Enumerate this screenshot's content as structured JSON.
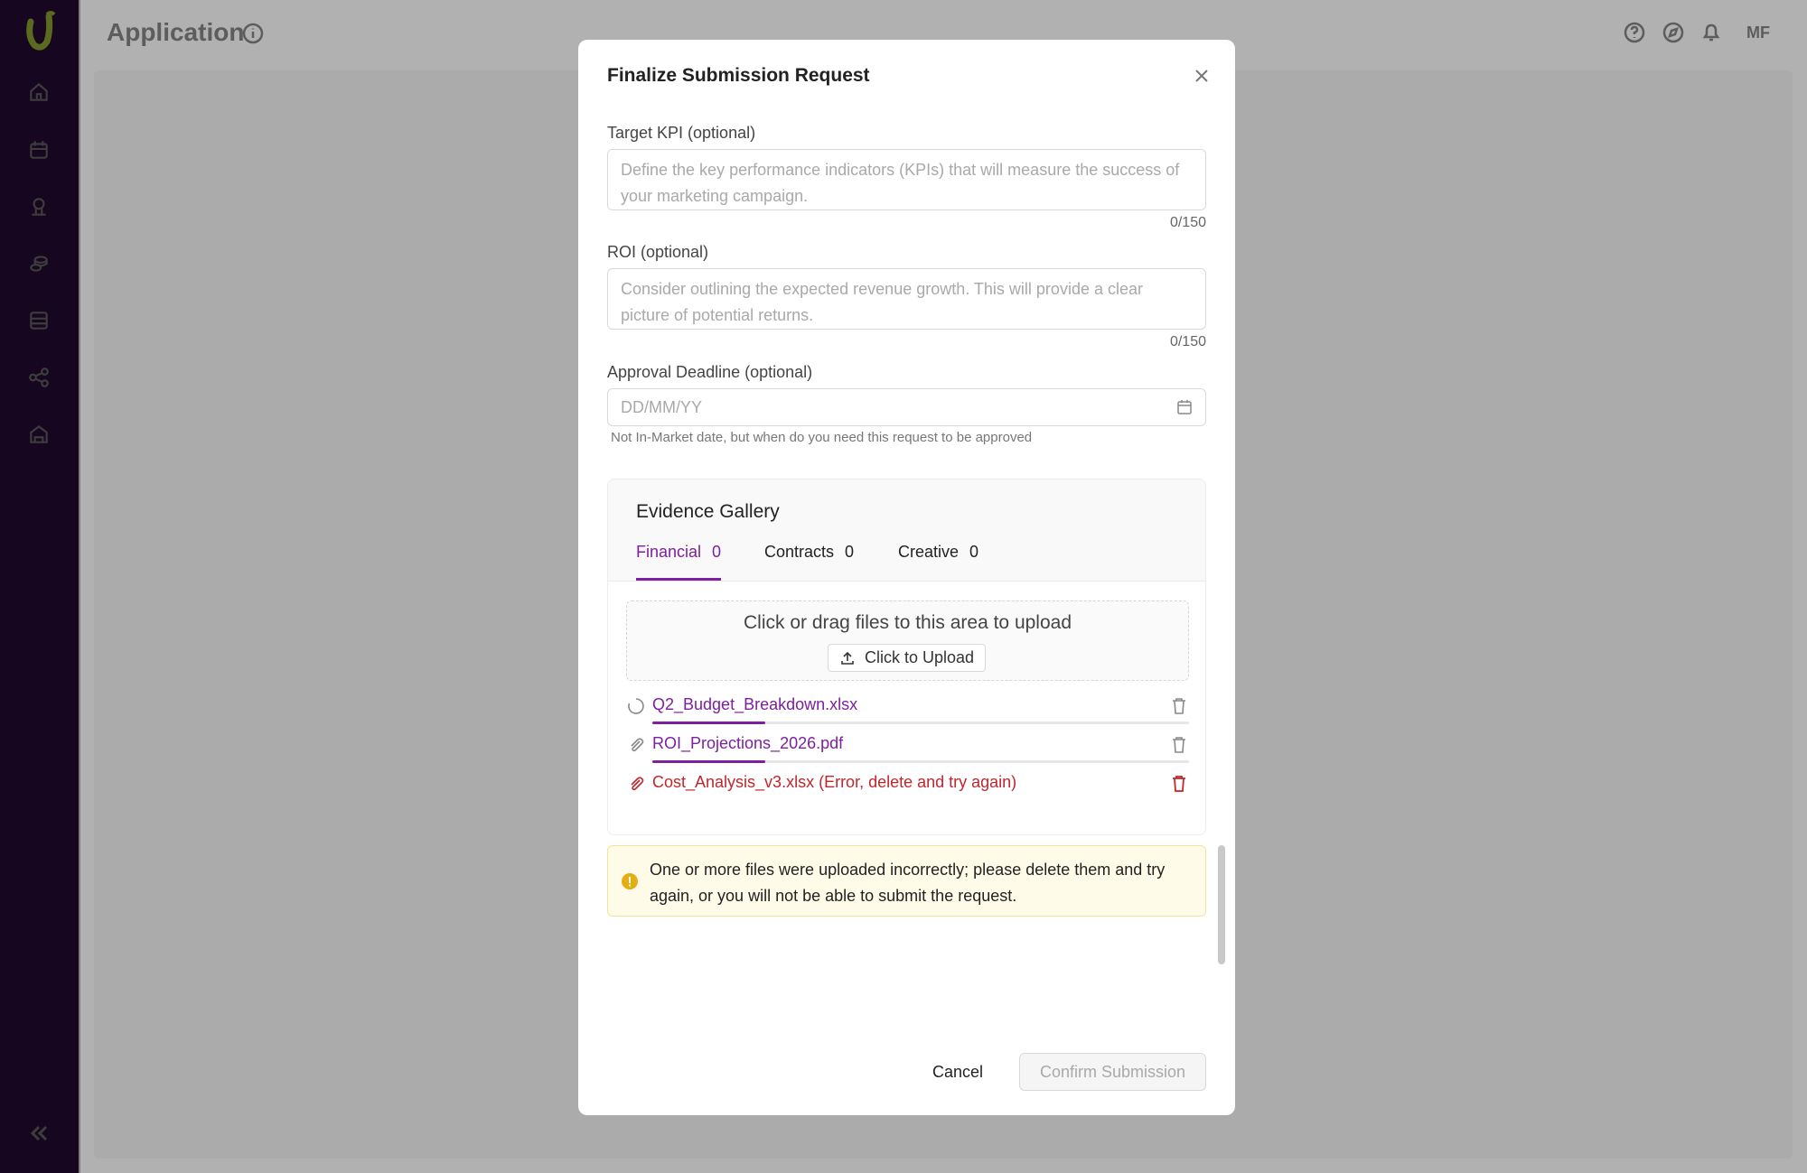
{
  "app": {
    "title": "Application",
    "user_initials": "MF",
    "sidebar_icons": [
      "home-icon",
      "calendar-icon",
      "user-badge-icon",
      "coins-icon",
      "table-icon",
      "share-icon",
      "store-icon"
    ]
  },
  "modal": {
    "title": "Finalize Submission Request",
    "target_kpi": {
      "label": "Target KPI (optional)",
      "placeholder": "Define the key performance indicators (KPIs) that will measure the success of your marketing campaign.",
      "counter": "0/150"
    },
    "roi": {
      "label": "ROI (optional)",
      "placeholder": "Consider outlining the expected revenue growth. This will provide a clear picture of potential returns.",
      "counter": "0/150"
    },
    "approval_deadline": {
      "label": "Approval Deadline (optional)",
      "placeholder": "DD/MM/YY",
      "hint": "Not In-Market date, but when do you need this request to be approved"
    },
    "gallery": {
      "title": "Evidence Gallery",
      "tabs": [
        {
          "label": "Financial",
          "count": "0",
          "active": true
        },
        {
          "label": "Contracts",
          "count": "0",
          "active": false
        },
        {
          "label": "Creative",
          "count": "0",
          "active": false
        }
      ],
      "dropzone_text": "Click or drag files to this area to upload",
      "upload_button": "Click to Upload",
      "files": [
        {
          "name": "Q2_Budget_Breakdown.xlsx",
          "status": "uploading",
          "progress": 0.21
        },
        {
          "name": "ROI_Projections_2026.pdf",
          "status": "uploading",
          "progress": 0.21
        },
        {
          "name": "Cost_Analysis_v3.xlsx (Error, delete and try again)",
          "status": "error"
        }
      ]
    },
    "alert": {
      "text": "One or more files were uploaded incorrectly; please delete them and try again, or you will not be able to submit the request."
    },
    "buttons": {
      "cancel": "Cancel",
      "confirm": "Confirm Submission"
    }
  },
  "colors": {
    "accent": "#7d1f9e",
    "error": "#c0262d",
    "warning": "#e5ad14",
    "sidebar_bg": "#16061f"
  }
}
